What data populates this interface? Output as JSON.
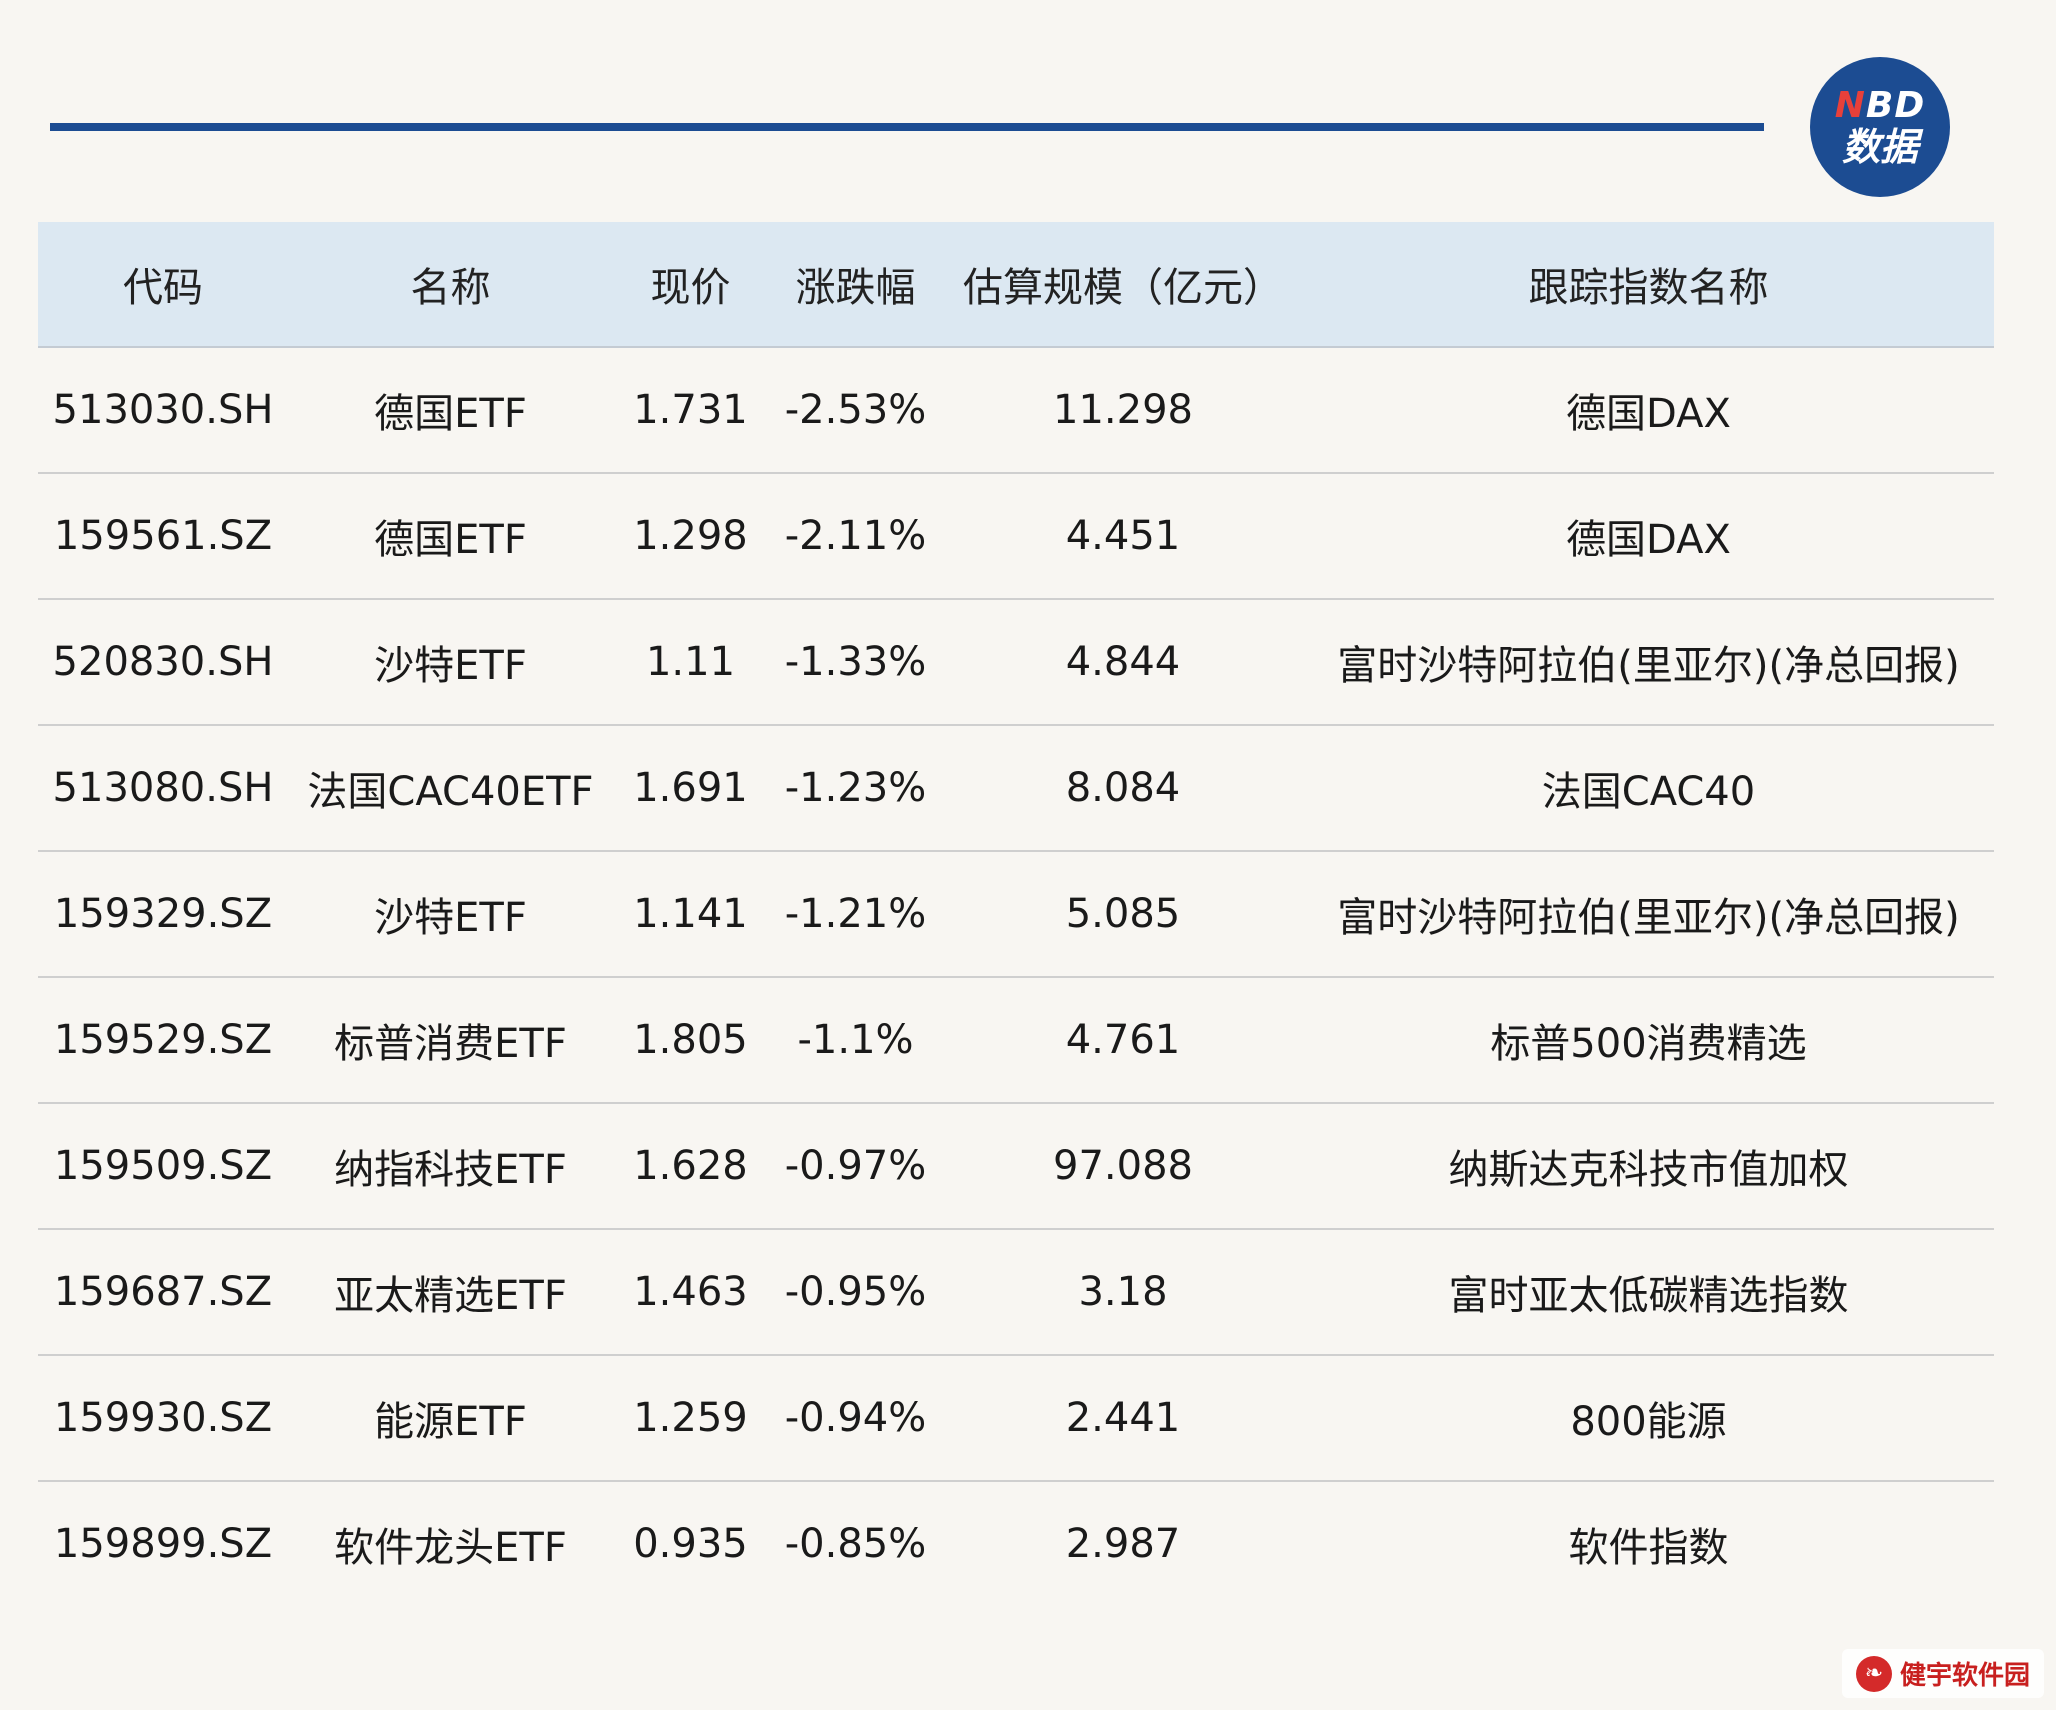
{
  "logo": {
    "top_n": "N",
    "top_rest": "BD",
    "bottom": "数据"
  },
  "table": {
    "headers": [
      "代码",
      "名称",
      "现价",
      "涨跌幅",
      "估算规模（亿元）",
      "跟踪指数名称"
    ],
    "rows": [
      [
        "513030.SH",
        "德国ETF",
        "1.731",
        "-2.53%",
        "11.298",
        "德国DAX"
      ],
      [
        "159561.SZ",
        "德国ETF",
        "1.298",
        "-2.11%",
        "4.451",
        "德国DAX"
      ],
      [
        "520830.SH",
        "沙特ETF",
        "1.11",
        "-1.33%",
        "4.844",
        "富时沙特阿拉伯(里亚尔)(净总回报)"
      ],
      [
        "513080.SH",
        "法国CAC40ETF",
        "1.691",
        "-1.23%",
        "8.084",
        "法国CAC40"
      ],
      [
        "159329.SZ",
        "沙特ETF",
        "1.141",
        "-1.21%",
        "5.085",
        "富时沙特阿拉伯(里亚尔)(净总回报)"
      ],
      [
        "159529.SZ",
        "标普消费ETF",
        "1.805",
        "-1.1%",
        "4.761",
        "标普500消费精选"
      ],
      [
        "159509.SZ",
        "纳指科技ETF",
        "1.628",
        "-0.97%",
        "97.088",
        "纳斯达克科技市值加权"
      ],
      [
        "159687.SZ",
        "亚太精选ETF",
        "1.463",
        "-0.95%",
        "3.18",
        "富时亚太低碳精选指数"
      ],
      [
        "159930.SZ",
        "能源ETF",
        "1.259",
        "-0.94%",
        "2.441",
        "800能源"
      ],
      [
        "159899.SZ",
        "软件龙头ETF",
        "0.935",
        "-0.85%",
        "2.987",
        "软件指数"
      ]
    ]
  },
  "brand": {
    "text": "健宇软件园"
  },
  "colors": {
    "rule": "#1c4c92",
    "header_bg": "#dce8f2",
    "page_bg": "#f8f6f2"
  }
}
